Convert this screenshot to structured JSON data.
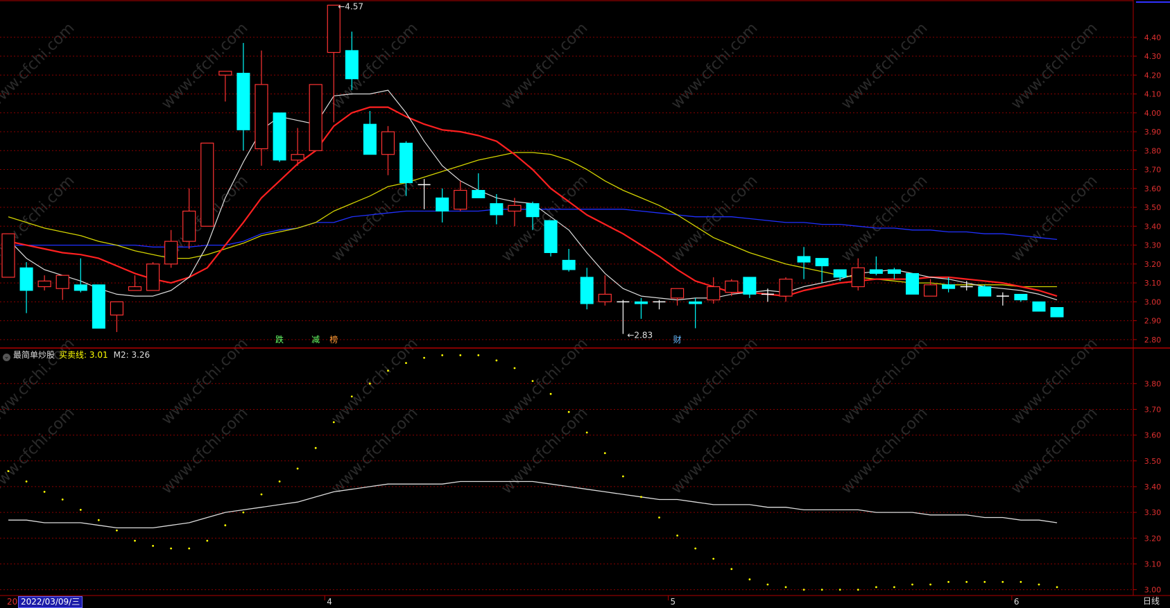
{
  "chart_data": {
    "type": "candlestick",
    "main": {
      "y_ticks": [
        2.8,
        2.9,
        3.0,
        3.1,
        3.2,
        3.3,
        3.4,
        3.5,
        3.6,
        3.7,
        3.8,
        3.9,
        4.0,
        4.1,
        4.2,
        4.3,
        4.4
      ],
      "ylim": [
        2.77,
        4.59
      ],
      "candles": [
        {
          "o": 3.13,
          "h": 3.36,
          "l": 3.13,
          "c": 3.36
        },
        {
          "o": 3.18,
          "h": 3.21,
          "l": 2.94,
          "c": 3.06
        },
        {
          "o": 3.08,
          "h": 3.14,
          "l": 3.06,
          "c": 3.11
        },
        {
          "o": 3.07,
          "h": 3.14,
          "l": 3.01,
          "c": 3.14
        },
        {
          "o": 3.09,
          "h": 3.23,
          "l": 3.05,
          "c": 3.06
        },
        {
          "o": 3.09,
          "h": 3.09,
          "l": 2.86,
          "c": 2.86
        },
        {
          "o": 2.93,
          "h": 3.0,
          "l": 2.84,
          "c": 3.0
        },
        {
          "o": 3.06,
          "h": 3.14,
          "l": 3.06,
          "c": 3.08
        },
        {
          "o": 3.06,
          "h": 3.21,
          "l": 3.06,
          "c": 3.2
        },
        {
          "o": 3.2,
          "h": 3.38,
          "l": 3.18,
          "c": 3.32
        },
        {
          "o": 3.32,
          "h": 3.6,
          "l": 3.28,
          "c": 3.48
        },
        {
          "o": 3.4,
          "h": 3.84,
          "l": 3.4,
          "c": 3.84
        },
        {
          "o": 4.2,
          "h": 4.22,
          "l": 4.06,
          "c": 4.22
        },
        {
          "o": 4.21,
          "h": 4.37,
          "l": 3.8,
          "c": 3.91
        },
        {
          "o": 3.81,
          "h": 4.33,
          "l": 3.72,
          "c": 4.15
        },
        {
          "o": 4.0,
          "h": 4.0,
          "l": 3.74,
          "c": 3.75
        },
        {
          "o": 3.75,
          "h": 3.92,
          "l": 3.72,
          "c": 3.78
        },
        {
          "o": 3.8,
          "h": 4.15,
          "l": 3.8,
          "c": 4.15
        },
        {
          "o": 4.32,
          "h": 4.57,
          "l": 3.95,
          "c": 4.57
        },
        {
          "o": 4.33,
          "h": 4.43,
          "l": 4.12,
          "c": 4.18
        },
        {
          "o": 3.94,
          "h": 4.01,
          "l": 3.84,
          "c": 3.78
        },
        {
          "o": 3.78,
          "h": 3.93,
          "l": 3.67,
          "c": 3.9
        },
        {
          "o": 3.84,
          "h": 3.85,
          "l": 3.56,
          "c": 3.63
        },
        {
          "o": 3.62,
          "h": 3.65,
          "l": 3.49,
          "c": 3.62
        },
        {
          "o": 3.55,
          "h": 3.6,
          "l": 3.42,
          "c": 3.48
        },
        {
          "o": 3.49,
          "h": 3.64,
          "l": 3.48,
          "c": 3.59
        },
        {
          "o": 3.59,
          "h": 3.68,
          "l": 3.55,
          "c": 3.55
        },
        {
          "o": 3.52,
          "h": 3.57,
          "l": 3.41,
          "c": 3.46
        },
        {
          "o": 3.48,
          "h": 3.55,
          "l": 3.4,
          "c": 3.51
        },
        {
          "o": 3.52,
          "h": 3.53,
          "l": 3.38,
          "c": 3.45
        },
        {
          "o": 3.43,
          "h": 3.43,
          "l": 3.24,
          "c": 3.26
        },
        {
          "o": 3.22,
          "h": 3.28,
          "l": 3.16,
          "c": 3.17
        },
        {
          "o": 3.13,
          "h": 3.18,
          "l": 2.96,
          "c": 2.99
        },
        {
          "o": 3.0,
          "h": 3.14,
          "l": 2.98,
          "c": 3.04
        },
        {
          "o": 3.0,
          "h": 3.01,
          "l": 2.83,
          "c": 3.0
        },
        {
          "o": 3.0,
          "h": 3.02,
          "l": 2.91,
          "c": 2.99
        },
        {
          "o": 3.0,
          "h": 3.01,
          "l": 2.96,
          "c": 3.0
        },
        {
          "o": 3.02,
          "h": 3.07,
          "l": 2.98,
          "c": 3.07
        },
        {
          "o": 3.0,
          "h": 3.02,
          "l": 2.86,
          "c": 2.99
        },
        {
          "o": 3.01,
          "h": 3.13,
          "l": 2.99,
          "c": 3.08
        },
        {
          "o": 3.05,
          "h": 3.12,
          "l": 3.03,
          "c": 3.11
        },
        {
          "o": 3.13,
          "h": 3.13,
          "l": 3.02,
          "c": 3.04
        },
        {
          "o": 3.04,
          "h": 3.07,
          "l": 3.0,
          "c": 3.04
        },
        {
          "o": 3.03,
          "h": 3.13,
          "l": 3.0,
          "c": 3.12
        },
        {
          "o": 3.24,
          "h": 3.29,
          "l": 3.12,
          "c": 3.21
        },
        {
          "o": 3.23,
          "h": 3.23,
          "l": 3.1,
          "c": 3.19
        },
        {
          "o": 3.17,
          "h": 3.17,
          "l": 3.11,
          "c": 3.13
        },
        {
          "o": 3.08,
          "h": 3.23,
          "l": 3.06,
          "c": 3.18
        },
        {
          "o": 3.17,
          "h": 3.24,
          "l": 3.14,
          "c": 3.15
        },
        {
          "o": 3.17,
          "h": 3.18,
          "l": 3.12,
          "c": 3.15
        },
        {
          "o": 3.15,
          "h": 3.15,
          "l": 3.04,
          "c": 3.04
        },
        {
          "o": 3.03,
          "h": 3.12,
          "l": 3.03,
          "c": 3.09
        },
        {
          "o": 3.09,
          "h": 3.13,
          "l": 3.05,
          "c": 3.07
        },
        {
          "o": 3.08,
          "h": 3.11,
          "l": 3.06,
          "c": 3.08
        },
        {
          "o": 3.08,
          "h": 3.09,
          "l": 3.03,
          "c": 3.03
        },
        {
          "o": 3.03,
          "h": 3.05,
          "l": 2.98,
          "c": 3.03
        },
        {
          "o": 3.04,
          "h": 3.04,
          "l": 3.0,
          "c": 3.01
        },
        {
          "o": 3.0,
          "h": 3.0,
          "l": 2.95,
          "c": 2.95
        },
        {
          "o": 2.97,
          "h": 2.97,
          "l": 2.92,
          "c": 2.92
        }
      ],
      "ma_white": [
        3.33,
        3.23,
        3.17,
        3.14,
        3.11,
        3.07,
        3.04,
        3.03,
        3.03,
        3.06,
        3.13,
        3.3,
        3.55,
        3.74,
        3.91,
        3.98,
        3.96,
        3.94,
        4.09,
        4.1,
        4.1,
        4.12,
        4.0,
        3.85,
        3.72,
        3.64,
        3.59,
        3.55,
        3.53,
        3.52,
        3.45,
        3.38,
        3.26,
        3.15,
        3.07,
        3.03,
        3.02,
        3.01,
        3.02,
        3.02,
        3.04,
        3.05,
        3.06,
        3.05,
        3.08,
        3.1,
        3.12,
        3.15,
        3.16,
        3.17,
        3.15,
        3.13,
        3.12,
        3.1,
        3.08,
        3.07,
        3.06,
        3.04,
        3.01
      ],
      "ma_red": [
        3.32,
        3.3,
        3.28,
        3.26,
        3.25,
        3.23,
        3.19,
        3.15,
        3.12,
        3.1,
        3.13,
        3.18,
        3.3,
        3.42,
        3.55,
        3.64,
        3.73,
        3.8,
        3.93,
        4.0,
        4.03,
        4.03,
        3.98,
        3.94,
        3.91,
        3.9,
        3.88,
        3.85,
        3.78,
        3.7,
        3.6,
        3.53,
        3.46,
        3.41,
        3.36,
        3.3,
        3.24,
        3.17,
        3.11,
        3.08,
        3.05,
        3.05,
        3.04,
        3.03,
        3.06,
        3.08,
        3.1,
        3.11,
        3.12,
        3.12,
        3.12,
        3.13,
        3.13,
        3.12,
        3.11,
        3.1,
        3.08,
        3.06,
        3.03
      ],
      "ma_yellow": [
        3.45,
        3.42,
        3.39,
        3.37,
        3.35,
        3.32,
        3.3,
        3.27,
        3.25,
        3.23,
        3.23,
        3.25,
        3.28,
        3.31,
        3.35,
        3.37,
        3.39,
        3.42,
        3.48,
        3.52,
        3.56,
        3.61,
        3.63,
        3.66,
        3.69,
        3.72,
        3.75,
        3.77,
        3.79,
        3.79,
        3.78,
        3.75,
        3.7,
        3.64,
        3.59,
        3.55,
        3.51,
        3.46,
        3.4,
        3.34,
        3.3,
        3.26,
        3.23,
        3.2,
        3.18,
        3.16,
        3.14,
        3.13,
        3.12,
        3.11,
        3.1,
        3.1,
        3.09,
        3.09,
        3.09,
        3.09,
        3.08,
        3.08,
        3.08
      ],
      "ma_blue": [
        3.3,
        3.3,
        3.3,
        3.3,
        3.3,
        3.3,
        3.3,
        3.3,
        3.29,
        3.29,
        3.29,
        3.3,
        3.3,
        3.32,
        3.36,
        3.38,
        3.39,
        3.42,
        3.42,
        3.45,
        3.46,
        3.47,
        3.48,
        3.48,
        3.48,
        3.48,
        3.48,
        3.49,
        3.49,
        3.49,
        3.49,
        3.49,
        3.49,
        3.49,
        3.49,
        3.48,
        3.47,
        3.46,
        3.45,
        3.45,
        3.45,
        3.44,
        3.43,
        3.42,
        3.42,
        3.41,
        3.41,
        3.4,
        3.39,
        3.39,
        3.38,
        3.38,
        3.37,
        3.37,
        3.36,
        3.36,
        3.35,
        3.34,
        3.33
      ],
      "high_marker": {
        "label": "4.57",
        "index": 18
      },
      "low_marker": {
        "label": "2.83",
        "index": 34
      },
      "event_labels": [
        {
          "text": "跌",
          "index": 15,
          "color": "#66ff66"
        },
        {
          "text": "减",
          "index": 17,
          "color": "#66ff66"
        },
        {
          "text": "榜",
          "index": 18,
          "color": "#ff9933"
        },
        {
          "text": "财",
          "index": 37,
          "color": "#66bbff"
        }
      ]
    },
    "indicator": {
      "name": "最简单炒股",
      "series": [
        {
          "name": "买卖线",
          "value_label": "3.01",
          "color": "#ffff00",
          "style": "dots",
          "values": [
            3.46,
            3.42,
            3.38,
            3.35,
            3.31,
            3.27,
            3.23,
            3.19,
            3.17,
            3.16,
            3.16,
            3.19,
            3.25,
            3.3,
            3.37,
            3.42,
            3.47,
            3.55,
            3.65,
            3.75,
            3.8,
            3.85,
            3.88,
            3.9,
            3.91,
            3.91,
            3.91,
            3.89,
            3.86,
            3.81,
            3.76,
            3.69,
            3.61,
            3.53,
            3.44,
            3.36,
            3.28,
            3.21,
            3.16,
            3.12,
            3.08,
            3.04,
            3.02,
            3.01,
            3.0,
            3.0,
            3.0,
            3.0,
            3.01,
            3.01,
            3.02,
            3.02,
            3.03,
            3.03,
            3.03,
            3.03,
            3.03,
            3.02,
            3.01
          ]
        },
        {
          "name": "M2",
          "value_label": "3.26",
          "color": "#dddddd",
          "style": "line",
          "values": [
            3.27,
            3.27,
            3.26,
            3.26,
            3.26,
            3.25,
            3.24,
            3.24,
            3.24,
            3.25,
            3.26,
            3.28,
            3.3,
            3.31,
            3.32,
            3.33,
            3.34,
            3.36,
            3.38,
            3.39,
            3.4,
            3.41,
            3.41,
            3.41,
            3.41,
            3.42,
            3.42,
            3.42,
            3.42,
            3.42,
            3.41,
            3.4,
            3.39,
            3.38,
            3.37,
            3.36,
            3.35,
            3.35,
            3.34,
            3.33,
            3.33,
            3.33,
            3.32,
            3.32,
            3.31,
            3.31,
            3.31,
            3.31,
            3.3,
            3.3,
            3.3,
            3.29,
            3.29,
            3.29,
            3.28,
            3.28,
            3.27,
            3.27,
            3.26
          ]
        }
      ],
      "y_ticks": [
        3.0,
        3.1,
        3.2,
        3.3,
        3.4,
        3.5,
        3.6,
        3.7,
        3.8
      ],
      "ylim": [
        2.98,
        3.93
      ]
    },
    "x_axis": {
      "labels": [
        {
          "text": "4",
          "index": 18
        },
        {
          "text": "5",
          "index": 37
        },
        {
          "text": "6",
          "index": 56
        }
      ],
      "cut_label": "20"
    },
    "cursor_date": "2022/03/09/三",
    "period": "日线",
    "watermark": "www.cfchi.com",
    "colors": {
      "up": "#ff3333",
      "down": "#00ffff",
      "grid": "#8a0000",
      "axis": "#b00000",
      "white_ma": "#dddddd",
      "red_ma": "#ff2020",
      "yellow_ma": "#d4d400",
      "blue_ma": "#2030ff"
    }
  }
}
